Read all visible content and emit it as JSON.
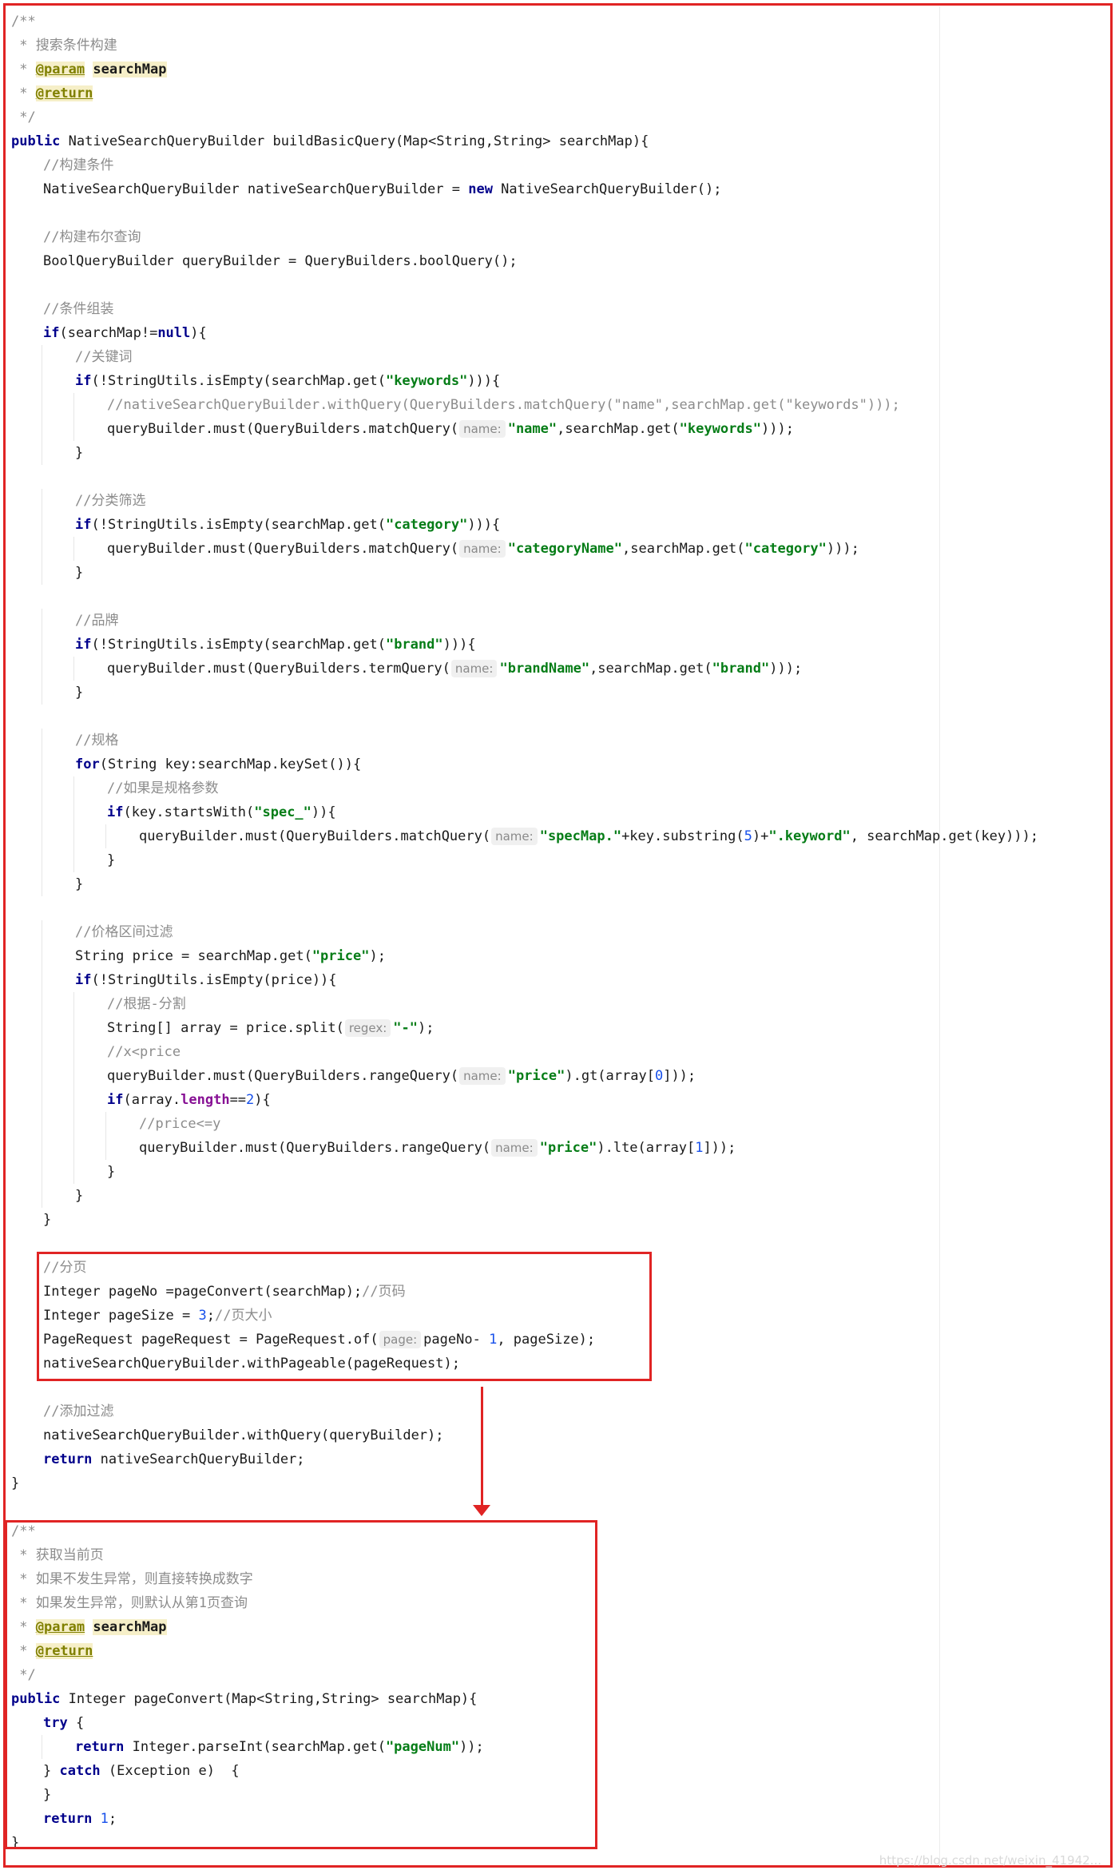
{
  "code_lines": [
    {
      "indent": 0,
      "tokens": [
        {
          "t": "/**",
          "c": "cmt"
        }
      ]
    },
    {
      "indent": 0,
      "tokens": [
        {
          "t": " * 搜索条件构建",
          "c": "cmt"
        }
      ]
    },
    {
      "indent": 0,
      "tokens": [
        {
          "t": " * ",
          "c": "cmt"
        },
        {
          "t": "@param",
          "c": "tag"
        },
        {
          "t": " ",
          "c": ""
        },
        {
          "t": "searchMap",
          "c": "hl"
        }
      ]
    },
    {
      "indent": 0,
      "tokens": [
        {
          "t": " * ",
          "c": "cmt"
        },
        {
          "t": "@return",
          "c": "tag"
        }
      ]
    },
    {
      "indent": 0,
      "tokens": [
        {
          "t": " */",
          "c": "cmt"
        }
      ]
    },
    {
      "indent": 0,
      "tokens": [
        {
          "t": "public",
          "c": "kw"
        },
        {
          "t": " NativeSearchQueryBuilder buildBasicQuery(Map<String,String> searchMap){",
          "c": ""
        }
      ]
    },
    {
      "indent": 1,
      "tokens": [
        {
          "t": "//构建条件",
          "c": "cmt"
        }
      ]
    },
    {
      "indent": 1,
      "tokens": [
        {
          "t": "NativeSearchQueryBuilder nativeSearchQueryBuilder = ",
          "c": ""
        },
        {
          "t": "new",
          "c": "kw"
        },
        {
          "t": " NativeSearchQueryBuilder();",
          "c": ""
        }
      ]
    },
    {
      "indent": 0,
      "tokens": []
    },
    {
      "indent": 1,
      "tokens": [
        {
          "t": "//构建布尔查询",
          "c": "cmt"
        }
      ]
    },
    {
      "indent": 1,
      "tokens": [
        {
          "t": "BoolQueryBuilder queryBuilder = QueryBuilders.boolQuery();",
          "c": ""
        }
      ]
    },
    {
      "indent": 0,
      "tokens": []
    },
    {
      "indent": 1,
      "tokens": [
        {
          "t": "//条件组装",
          "c": "cmt"
        }
      ]
    },
    {
      "indent": 1,
      "tokens": [
        {
          "t": "if",
          "c": "kw"
        },
        {
          "t": "(searchMap!=",
          "c": ""
        },
        {
          "t": "null",
          "c": "kw"
        },
        {
          "t": "){",
          "c": ""
        }
      ]
    },
    {
      "indent": 2,
      "tokens": [
        {
          "t": "//关键词",
          "c": "cmt"
        }
      ]
    },
    {
      "indent": 2,
      "tokens": [
        {
          "t": "if",
          "c": "kw"
        },
        {
          "t": "(!StringUtils.isEmpty(searchMap.get(",
          "c": ""
        },
        {
          "t": "\"keywords\"",
          "c": "str"
        },
        {
          "t": "))){",
          "c": ""
        }
      ]
    },
    {
      "indent": 3,
      "tokens": [
        {
          "t": "//nativeSearchQueryBuilder.withQuery(QueryBuilders.matchQuery(\"name\",searchMap.get(\"keywords\")));",
          "c": "cmt"
        }
      ]
    },
    {
      "indent": 3,
      "tokens": [
        {
          "t": "queryBuilder.must(QueryBuilders.matchQuery(",
          "c": ""
        },
        {
          "t": "name:",
          "c": "hint"
        },
        {
          "t": "\"name\"",
          "c": "str"
        },
        {
          "t": ",searchMap.get(",
          "c": ""
        },
        {
          "t": "\"keywords\"",
          "c": "str"
        },
        {
          "t": ")));",
          "c": ""
        }
      ]
    },
    {
      "indent": 2,
      "tokens": [
        {
          "t": "}",
          "c": ""
        }
      ]
    },
    {
      "indent": 0,
      "tokens": []
    },
    {
      "indent": 2,
      "tokens": [
        {
          "t": "//分类筛选",
          "c": "cmt"
        }
      ]
    },
    {
      "indent": 2,
      "tokens": [
        {
          "t": "if",
          "c": "kw"
        },
        {
          "t": "(!StringUtils.isEmpty(searchMap.get(",
          "c": ""
        },
        {
          "t": "\"category\"",
          "c": "str"
        },
        {
          "t": "))){",
          "c": ""
        }
      ]
    },
    {
      "indent": 3,
      "tokens": [
        {
          "t": "queryBuilder.must(QueryBuilders.matchQuery(",
          "c": ""
        },
        {
          "t": "name:",
          "c": "hint"
        },
        {
          "t": "\"categoryName\"",
          "c": "str"
        },
        {
          "t": ",searchMap.get(",
          "c": ""
        },
        {
          "t": "\"category\"",
          "c": "str"
        },
        {
          "t": ")));",
          "c": ""
        }
      ]
    },
    {
      "indent": 2,
      "tokens": [
        {
          "t": "}",
          "c": ""
        }
      ]
    },
    {
      "indent": 0,
      "tokens": []
    },
    {
      "indent": 2,
      "tokens": [
        {
          "t": "//品牌",
          "c": "cmt"
        }
      ]
    },
    {
      "indent": 2,
      "tokens": [
        {
          "t": "if",
          "c": "kw"
        },
        {
          "t": "(!StringUtils.isEmpty(searchMap.get(",
          "c": ""
        },
        {
          "t": "\"brand\"",
          "c": "str"
        },
        {
          "t": "))){",
          "c": ""
        }
      ]
    },
    {
      "indent": 3,
      "tokens": [
        {
          "t": "queryBuilder.must(QueryBuilders.termQuery(",
          "c": ""
        },
        {
          "t": "name:",
          "c": "hint"
        },
        {
          "t": "\"brandName\"",
          "c": "str"
        },
        {
          "t": ",searchMap.get(",
          "c": ""
        },
        {
          "t": "\"brand\"",
          "c": "str"
        },
        {
          "t": ")));",
          "c": ""
        }
      ]
    },
    {
      "indent": 2,
      "tokens": [
        {
          "t": "}",
          "c": ""
        }
      ]
    },
    {
      "indent": 0,
      "tokens": []
    },
    {
      "indent": 2,
      "tokens": [
        {
          "t": "//规格",
          "c": "cmt"
        }
      ]
    },
    {
      "indent": 2,
      "tokens": [
        {
          "t": "for",
          "c": "kw"
        },
        {
          "t": "(String key:searchMap.keySet()){",
          "c": ""
        }
      ]
    },
    {
      "indent": 3,
      "tokens": [
        {
          "t": "//如果是规格参数",
          "c": "cmt"
        }
      ]
    },
    {
      "indent": 3,
      "tokens": [
        {
          "t": "if",
          "c": "kw"
        },
        {
          "t": "(key.startsWith(",
          "c": ""
        },
        {
          "t": "\"spec_\"",
          "c": "str"
        },
        {
          "t": ")){",
          "c": ""
        }
      ]
    },
    {
      "indent": 4,
      "tokens": [
        {
          "t": "queryBuilder.must(QueryBuilders.matchQuery(",
          "c": ""
        },
        {
          "t": "name:",
          "c": "hint"
        },
        {
          "t": "\"specMap.\"",
          "c": "str"
        },
        {
          "t": "+key.substring(",
          "c": ""
        },
        {
          "t": "5",
          "c": "num"
        },
        {
          "t": ")+",
          "c": ""
        },
        {
          "t": "\".keyword\"",
          "c": "str"
        },
        {
          "t": ", searchMap.get(key)));",
          "c": ""
        }
      ]
    },
    {
      "indent": 3,
      "tokens": [
        {
          "t": "}",
          "c": ""
        }
      ]
    },
    {
      "indent": 2,
      "tokens": [
        {
          "t": "}",
          "c": ""
        }
      ]
    },
    {
      "indent": 0,
      "tokens": []
    },
    {
      "indent": 2,
      "tokens": [
        {
          "t": "//价格区间过滤",
          "c": "cmt"
        }
      ]
    },
    {
      "indent": 2,
      "tokens": [
        {
          "t": "String price = searchMap.get(",
          "c": ""
        },
        {
          "t": "\"price\"",
          "c": "str"
        },
        {
          "t": ");",
          "c": ""
        }
      ]
    },
    {
      "indent": 2,
      "tokens": [
        {
          "t": "if",
          "c": "kw"
        },
        {
          "t": "(!StringUtils.isEmpty(price)){",
          "c": ""
        }
      ]
    },
    {
      "indent": 3,
      "tokens": [
        {
          "t": "//根据-分割",
          "c": "cmt"
        }
      ]
    },
    {
      "indent": 3,
      "tokens": [
        {
          "t": "String[] array = price.split(",
          "c": ""
        },
        {
          "t": "regex:",
          "c": "hint"
        },
        {
          "t": "\"-\"",
          "c": "str"
        },
        {
          "t": ");",
          "c": ""
        }
      ]
    },
    {
      "indent": 3,
      "tokens": [
        {
          "t": "//x<price",
          "c": "cmt"
        }
      ]
    },
    {
      "indent": 3,
      "tokens": [
        {
          "t": "queryBuilder.must(QueryBuilders.rangeQuery(",
          "c": ""
        },
        {
          "t": "name:",
          "c": "hint"
        },
        {
          "t": "\"price\"",
          "c": "str"
        },
        {
          "t": ").gt(array[",
          "c": ""
        },
        {
          "t": "0",
          "c": "num"
        },
        {
          "t": "]));",
          "c": ""
        }
      ]
    },
    {
      "indent": 3,
      "tokens": [
        {
          "t": "if",
          "c": "kw"
        },
        {
          "t": "(array.",
          "c": ""
        },
        {
          "t": "length",
          "c": "fld"
        },
        {
          "t": "==",
          "c": ""
        },
        {
          "t": "2",
          "c": "num"
        },
        {
          "t": "){",
          "c": ""
        }
      ]
    },
    {
      "indent": 4,
      "tokens": [
        {
          "t": "//price<=y",
          "c": "cmt"
        }
      ]
    },
    {
      "indent": 4,
      "tokens": [
        {
          "t": "queryBuilder.must(QueryBuilders.rangeQuery(",
          "c": ""
        },
        {
          "t": "name:",
          "c": "hint"
        },
        {
          "t": "\"price\"",
          "c": "str"
        },
        {
          "t": ").lte(array[",
          "c": ""
        },
        {
          "t": "1",
          "c": "num"
        },
        {
          "t": "]));",
          "c": ""
        }
      ]
    },
    {
      "indent": 3,
      "tokens": [
        {
          "t": "}",
          "c": ""
        }
      ]
    },
    {
      "indent": 2,
      "tokens": [
        {
          "t": "}",
          "c": ""
        }
      ]
    },
    {
      "indent": 1,
      "tokens": [
        {
          "t": "}",
          "c": ""
        }
      ]
    },
    {
      "indent": 0,
      "tokens": []
    },
    {
      "indent": 1,
      "tokens": [
        {
          "t": "//分页",
          "c": "cmt"
        }
      ]
    },
    {
      "indent": 1,
      "tokens": [
        {
          "t": "Integer pageNo =pageConvert(searchMap);",
          "c": ""
        },
        {
          "t": "//页码",
          "c": "cmt"
        }
      ]
    },
    {
      "indent": 1,
      "tokens": [
        {
          "t": "Integer pageSize = ",
          "c": ""
        },
        {
          "t": "3",
          "c": "num"
        },
        {
          "t": ";",
          "c": ""
        },
        {
          "t": "//页大小",
          "c": "cmt"
        }
      ]
    },
    {
      "indent": 1,
      "tokens": [
        {
          "t": "PageRequest pageRequest = PageRequest.of(",
          "c": ""
        },
        {
          "t": "page:",
          "c": "hint"
        },
        {
          "t": "pageNo- ",
          "c": ""
        },
        {
          "t": "1",
          "c": "num"
        },
        {
          "t": ", pageSize);",
          "c": ""
        }
      ]
    },
    {
      "indent": 1,
      "tokens": [
        {
          "t": "nativeSearchQueryBuilder.withPageable(pageRequest);",
          "c": ""
        }
      ]
    },
    {
      "indent": 0,
      "tokens": []
    },
    {
      "indent": 1,
      "tokens": [
        {
          "t": "//添加过滤",
          "c": "cmt"
        }
      ]
    },
    {
      "indent": 1,
      "tokens": [
        {
          "t": "nativeSearchQueryBuilder.withQuery(queryBuilder);",
          "c": ""
        }
      ]
    },
    {
      "indent": 1,
      "tokens": [
        {
          "t": "return",
          "c": "kw"
        },
        {
          "t": " nativeSearchQueryBuilder;",
          "c": ""
        }
      ]
    },
    {
      "indent": 0,
      "tokens": [
        {
          "t": "}",
          "c": ""
        }
      ]
    },
    {
      "indent": 0,
      "tokens": []
    },
    {
      "indent": 0,
      "tokens": [
        {
          "t": "/**",
          "c": "cmt"
        }
      ]
    },
    {
      "indent": 0,
      "tokens": [
        {
          "t": " * 获取当前页",
          "c": "cmt"
        }
      ]
    },
    {
      "indent": 0,
      "tokens": [
        {
          "t": " * 如果不发生异常，则直接转换成数字",
          "c": "cmt"
        }
      ]
    },
    {
      "indent": 0,
      "tokens": [
        {
          "t": " * 如果发生异常，则默认从第1页查询",
          "c": "cmt"
        }
      ]
    },
    {
      "indent": 0,
      "tokens": [
        {
          "t": " * ",
          "c": "cmt"
        },
        {
          "t": "@param",
          "c": "tag"
        },
        {
          "t": " ",
          "c": ""
        },
        {
          "t": "searchMap",
          "c": "hl"
        }
      ]
    },
    {
      "indent": 0,
      "tokens": [
        {
          "t": " * ",
          "c": "cmt"
        },
        {
          "t": "@return",
          "c": "tag"
        }
      ]
    },
    {
      "indent": 0,
      "tokens": [
        {
          "t": " */",
          "c": "cmt"
        }
      ]
    },
    {
      "indent": 0,
      "tokens": [
        {
          "t": "public",
          "c": "kw"
        },
        {
          "t": " Integer pageConvert(Map<String,String> searchMap){",
          "c": ""
        }
      ]
    },
    {
      "indent": 1,
      "tokens": [
        {
          "t": "try",
          "c": "kw"
        },
        {
          "t": " {",
          "c": ""
        }
      ]
    },
    {
      "indent": 2,
      "tokens": [
        {
          "t": "return",
          "c": "kw"
        },
        {
          "t": " Integer.parseInt(searchMap.get(",
          "c": ""
        },
        {
          "t": "\"pageNum\"",
          "c": "str"
        },
        {
          "t": "));",
          "c": ""
        }
      ]
    },
    {
      "indent": 1,
      "tokens": [
        {
          "t": "} ",
          "c": ""
        },
        {
          "t": "catch",
          "c": "kw"
        },
        {
          "t": " (Exception e)  {",
          "c": ""
        }
      ]
    },
    {
      "indent": 1,
      "tokens": [
        {
          "t": "}",
          "c": ""
        }
      ]
    },
    {
      "indent": 1,
      "tokens": [
        {
          "t": "return",
          "c": "kw"
        },
        {
          "t": " ",
          "c": ""
        },
        {
          "t": "1",
          "c": "num"
        },
        {
          "t": ";",
          "c": ""
        }
      ]
    },
    {
      "indent": 0,
      "tokens": [
        {
          "t": "}",
          "c": ""
        }
      ]
    }
  ],
  "watermark": "https://blog.csdn.net/weixin_41942...",
  "colors": {
    "highlight_box": "#e02424",
    "keyword": "#00008b",
    "string": "#067d17",
    "comment": "#8c8c8c",
    "number": "#1750eb"
  }
}
